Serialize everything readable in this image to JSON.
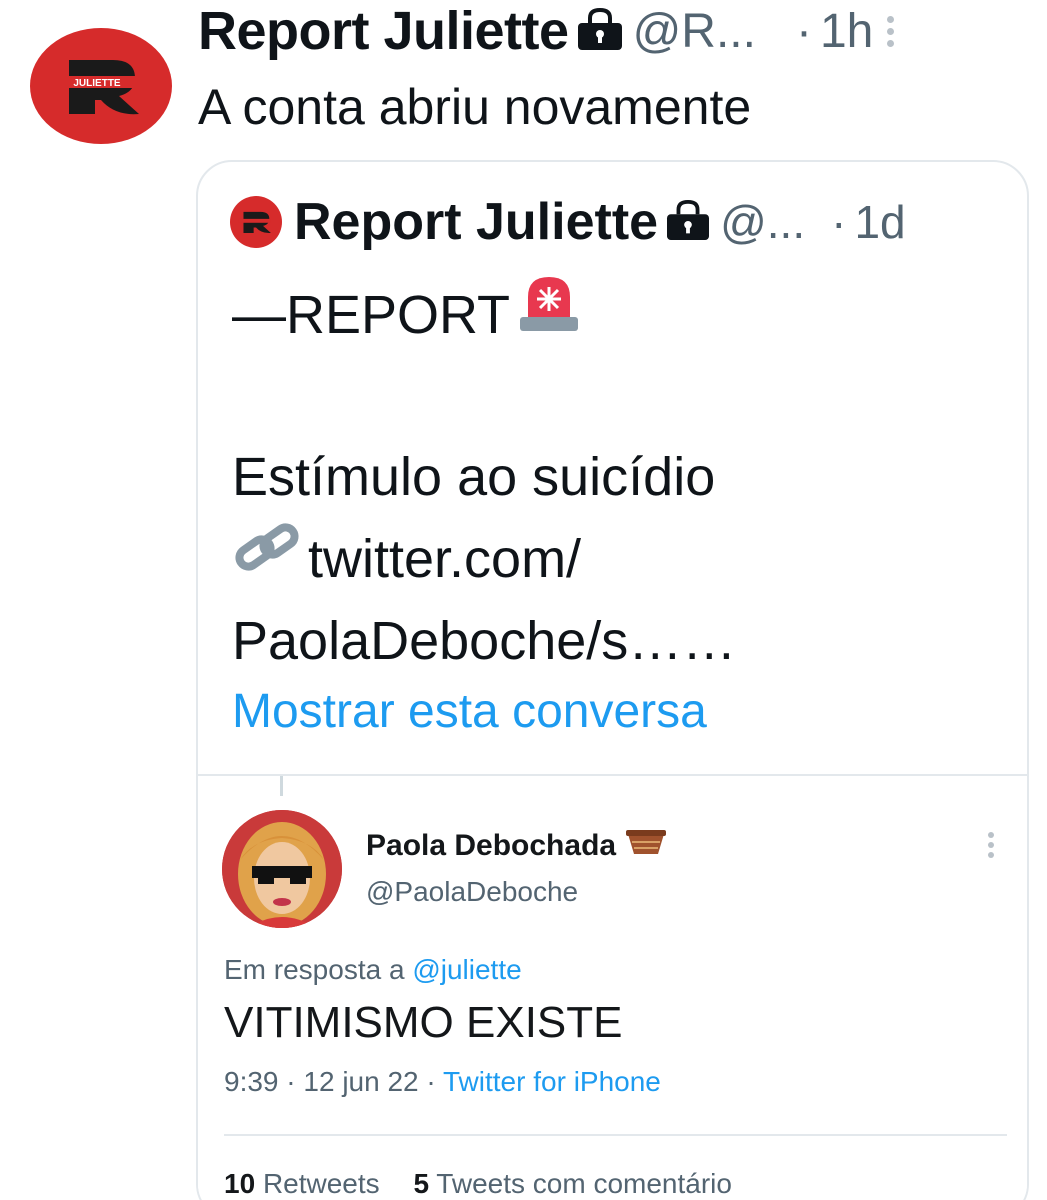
{
  "tweet": {
    "author_name": "Report Juliette",
    "handle": "@R...",
    "separator": "·",
    "time": "1h",
    "text": "A conta abriu novamente",
    "avatar_logo_text": "JULIETTE",
    "icons": [
      "lock-icon",
      "more-vertical-icon"
    ]
  },
  "quoted": {
    "author_name": "Report Juliette",
    "handle": "@...",
    "separator": "·",
    "time": "1d",
    "line1": "—REPORT",
    "line2": "Estímulo ao suicídio",
    "line3": "twitter.com/",
    "line4": "PaolaDeboche/s……",
    "show_conversation": "Mostrar esta conversa",
    "icons": [
      "rotating-light-icon",
      "link-icon"
    ]
  },
  "embedded": {
    "author_name": "Paola Debochada",
    "handle": "@PaolaDeboche",
    "reply_prefix": "Em resposta a",
    "reply_mention": "@juliette",
    "text": "VITIMISMO EXISTE",
    "time": "9:39",
    "date": "12 jun 22",
    "source": "Twitter for iPhone",
    "meta_sep": "·",
    "retweets_count": "10",
    "retweets_label": "Retweets",
    "quotes_count": "5",
    "quotes_label": "Tweets com comentário"
  },
  "colors": {
    "accent": "#1d9bf0",
    "brand_red": "#d62b2b",
    "muted": "#536471"
  }
}
